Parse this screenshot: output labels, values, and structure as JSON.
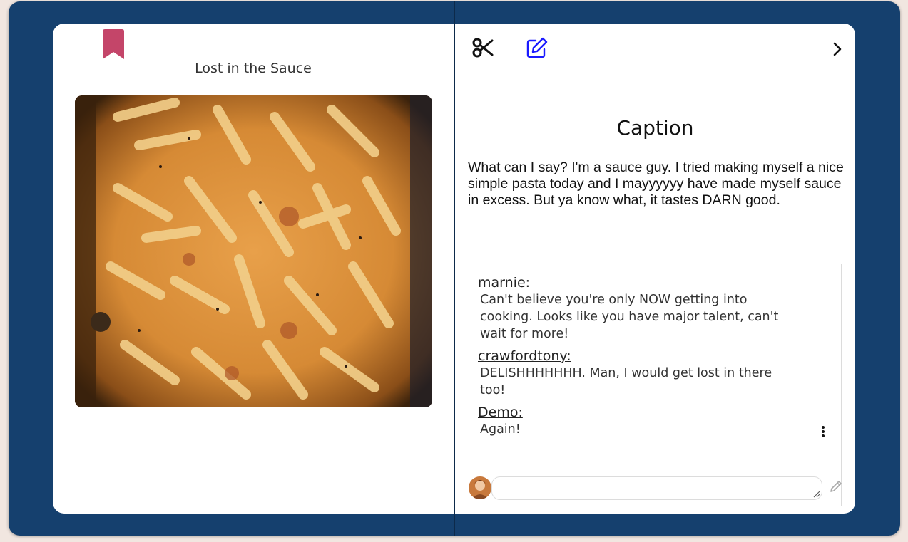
{
  "post": {
    "title": "Lost in the Sauce",
    "photo_icon": "pasta-photo"
  },
  "toolbar": {
    "scissors_icon": "scissors-icon",
    "edit_icon": "edit-icon",
    "next_icon": "chevron-right-icon"
  },
  "caption": {
    "heading": "Caption",
    "text": "What can I say? I'm a sauce guy. I tried making myself a nice simple pasta today and I mayyyyyy have made myself sauce in excess. But ya know what, it tastes DARN good."
  },
  "comments": [
    {
      "author": "marnie:",
      "body": "Can't believe you're only NOW getting into\ncooking. Looks like you have major talent, can't\nwait for more!"
    },
    {
      "author": "crawfordtony:",
      "body": "DELISHHHHHHH. Man, I would get lost in there\ntoo!"
    },
    {
      "author": "Demo:",
      "body": "Again!"
    }
  ],
  "comment_form": {
    "placeholder": "",
    "value": ""
  },
  "colors": {
    "cover": "#15406e",
    "bookmark": "#c44569",
    "edit_icon": "#1a1aff"
  }
}
